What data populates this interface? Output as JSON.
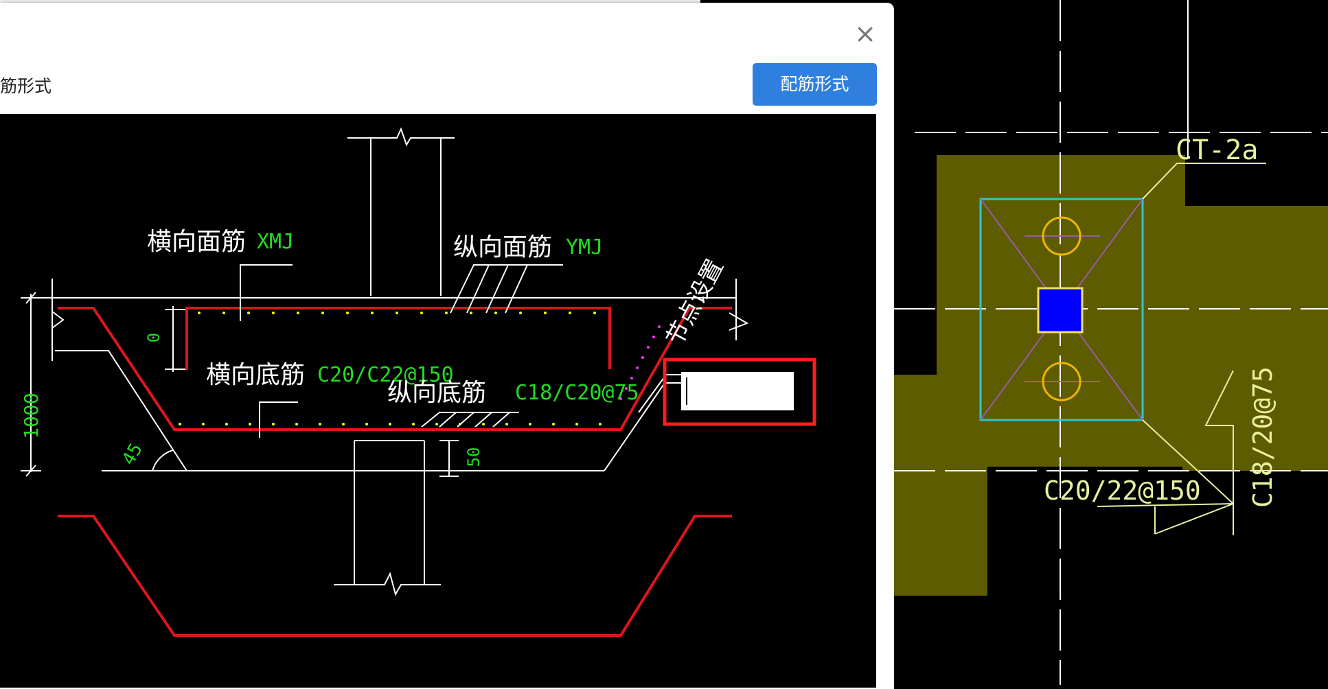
{
  "dialog": {
    "header_label": "筋形式",
    "rebar_form_button": "配筋形式",
    "close_symbol": "×"
  },
  "preview": {
    "top_transverse_label": "横向面筋",
    "top_transverse_code": "XMJ",
    "top_longitudinal_label": "纵向面筋",
    "top_longitudinal_code": "YMJ",
    "node_setting_label": "节点设置",
    "bottom_transverse_label": "横向底筋",
    "bottom_transverse_value": "C20/C22@150",
    "bottom_longitudinal_label": "纵向底筋",
    "bottom_longitudinal_value": "C18/C20@75",
    "dim_height": "1000",
    "dim_top_cover": "0",
    "dim_angle": "45",
    "dim_bottom_cover": "50",
    "node_input_value": ""
  },
  "cad": {
    "cap_label": "CT-2a",
    "rebar_label_horizontal": "C20/22@150",
    "rebar_label_vertical": "C18/20@75"
  },
  "colors": {
    "rebar_red": "#e0151b",
    "label_green": "#22dd22",
    "button_blue": "#2f80de",
    "cap_fill": "#5d5c00",
    "cyan_outline": "#30c8c8",
    "column_blue": "#0000ff",
    "highlight_red": "#ff1c1c"
  }
}
